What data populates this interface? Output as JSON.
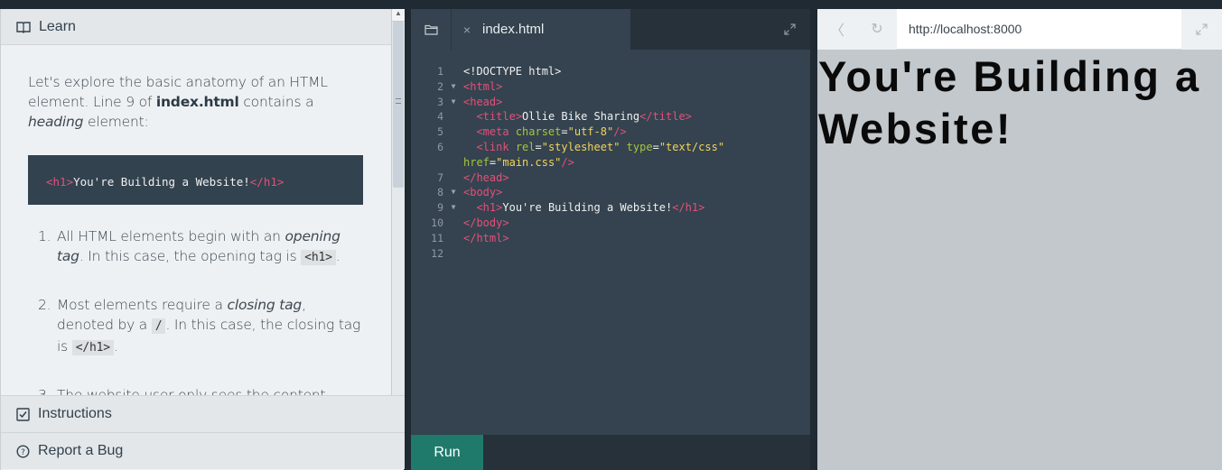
{
  "learn": {
    "header": "Learn",
    "intro_1": "Let's explore the basic anatomy of an HTML element. Line 9 of ",
    "intro_file": "index.html",
    "intro_2": " contains a ",
    "intro_em": "heading",
    "intro_3": " element:",
    "example": {
      "open": "<h1>",
      "text": "You're Building a Website!",
      "close": "</h1>"
    },
    "steps": [
      {
        "num": "1.",
        "a": "All HTML elements begin with an ",
        "em": "opening tag",
        "b": ". In this case, the opening tag is ",
        "code": "<h1>",
        "c": "."
      },
      {
        "num": "2.",
        "a": "Most elements require a ",
        "em": "closing tag",
        "b": ", denoted by a ",
        "code": "/",
        "c": ". In this case, the closing tag is ",
        "code2": "</h1>",
        "d": "."
      },
      {
        "num": "3.",
        "a": "The website user only sees the content between the opening and closing tags."
      }
    ],
    "footer": {
      "instructions": "Instructions",
      "report": "Report a Bug"
    }
  },
  "editor": {
    "tab_close": "×",
    "file_name": "index.html",
    "run_label": "Run",
    "lines": [
      {
        "n": "1",
        "fold": "",
        "html": "<!DOCTYPE html>"
      },
      {
        "n": "2",
        "fold": "▼",
        "html": "<html>"
      },
      {
        "n": "3",
        "fold": "▼",
        "html": "<head>"
      },
      {
        "n": "4",
        "fold": "",
        "html": "  <title>Ollie Bike Sharing</title>"
      },
      {
        "n": "5",
        "fold": "",
        "html": "  <meta charset=\"utf-8\"/>"
      },
      {
        "n": "6",
        "fold": "",
        "html": "  <link rel=\"stylesheet\" type=\"text/css\""
      },
      {
        "n": "",
        "fold": "",
        "html": "href=\"main.css\"/>"
      },
      {
        "n": "7",
        "fold": "",
        "html": "</head>"
      },
      {
        "n": "8",
        "fold": "▼",
        "html": "<body>"
      },
      {
        "n": "9",
        "fold": "▼",
        "html": "  <h1>You're Building a Website!</h1>"
      },
      {
        "n": "10",
        "fold": "",
        "html": "</body>"
      },
      {
        "n": "11",
        "fold": "",
        "html": "</html>"
      },
      {
        "n": "12",
        "fold": "",
        "html": ""
      }
    ]
  },
  "browser": {
    "back": "〈",
    "refresh": "↻",
    "url": "http://localhost:8000",
    "heading": "You're Building a Website!"
  }
}
